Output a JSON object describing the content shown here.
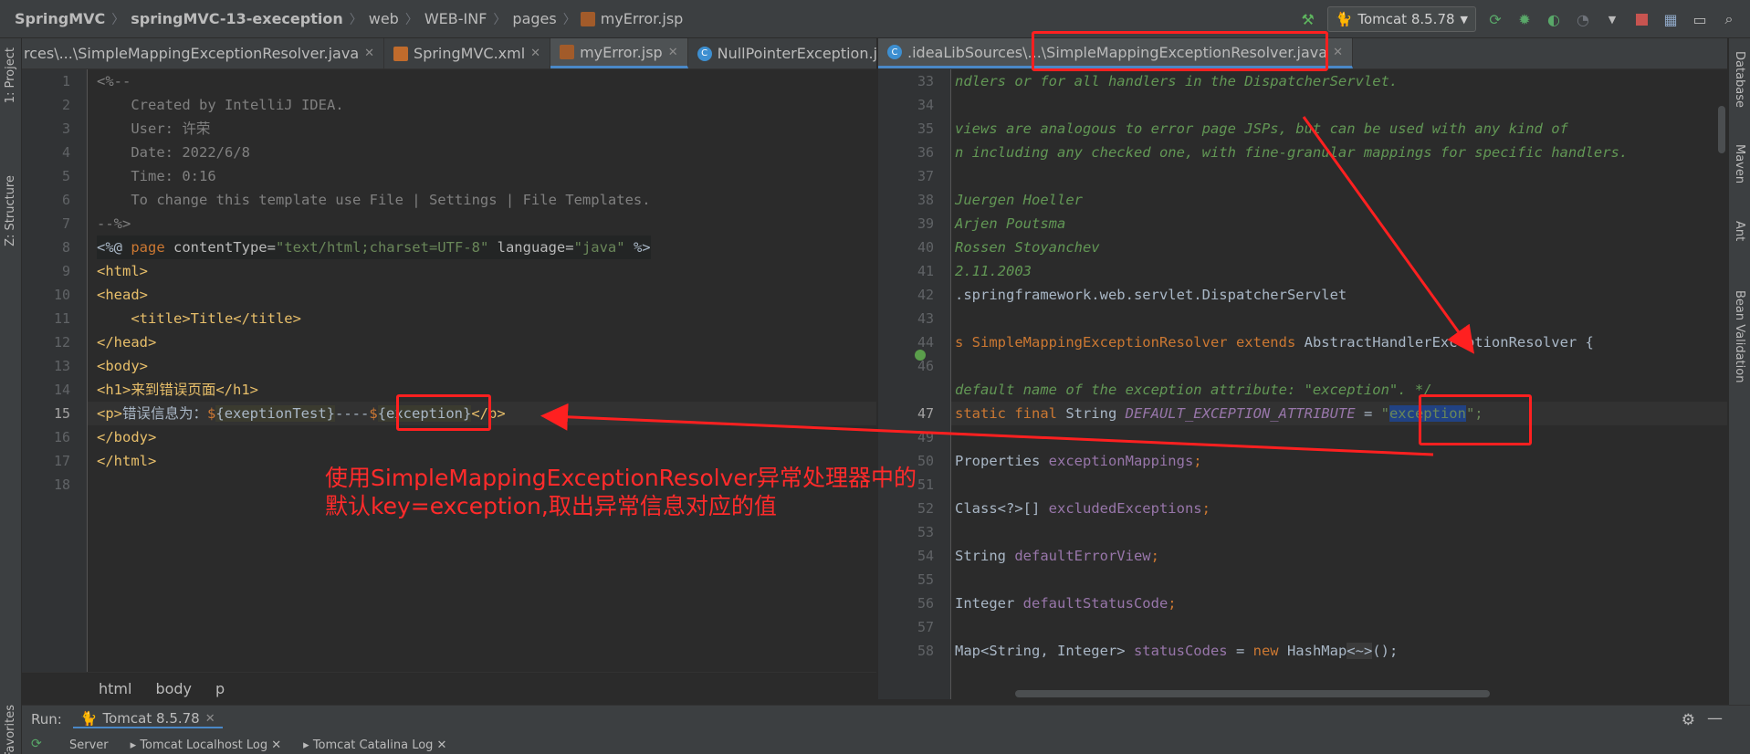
{
  "breadcrumbs": [
    {
      "label": "SpringMVC",
      "bold": true
    },
    {
      "label": "springMVC-13-exeception",
      "bold": true
    },
    {
      "label": "web",
      "bold": false
    },
    {
      "label": "WEB-INF",
      "bold": false
    },
    {
      "label": "pages",
      "bold": false
    },
    {
      "label": "myError.jsp",
      "bold": false
    }
  ],
  "toolbar": {
    "run_config": "Tomcat 8.5.78",
    "icons": [
      "hammer-icon",
      "rerun-icon",
      "debug-icon",
      "coverage-icon",
      "profile-icon",
      "stop-icon",
      "project-structure-icon",
      "terminal-icon",
      "search-icon"
    ]
  },
  "left_tool_strip": {
    "project": "1: Project",
    "structure": "Z: Structure",
    "favorites": "Favorites"
  },
  "right_tool_strip": {
    "database": "Database",
    "maven": "Maven",
    "ant": "Ant",
    "bean_validation": "Bean Validation"
  },
  "left_tabs": [
    {
      "label": "rces\\...\\SimpleMappingExceptionResolver.java",
      "icon": "java",
      "active": false,
      "close": true
    },
    {
      "label": "SpringMVC.xml",
      "icon": "xml",
      "active": false,
      "close": true
    },
    {
      "label": "myError.jsp",
      "icon": "jsp",
      "active": true,
      "close": true
    },
    {
      "label": "NullPointerException.jav",
      "icon": "java",
      "active": false,
      "close": false
    }
  ],
  "right_tabs": [
    {
      "label": ".ideaLibSources\\...\\SimpleMappingExceptionResolver.java",
      "icon": "java",
      "active": true,
      "close": true
    }
  ],
  "left_editor": {
    "line_numbers": [
      "1",
      "2",
      "3",
      "4",
      "5",
      "6",
      "7",
      "8",
      "9",
      "10",
      "11",
      "12",
      "13",
      "14",
      "15",
      "16",
      "17",
      "18"
    ],
    "current_line": "15",
    "lines": [
      "<%--",
      "    Created by IntelliJ IDEA.",
      "    User: 许荣",
      "    Date: 2022/6/8",
      "    Time: 0:16",
      "    To change this template use File | Settings | File Templates.",
      "--%>",
      "<%@ page contentType=\"text/html;charset=UTF-8\" language=\"java\" %>",
      "<html>",
      "<head>",
      "    <title>Title</title>",
      "</head>",
      "<body>",
      "<h1>来到错误页面</h1>",
      "<p>错误信息为：${exeptionTest}----${exception}</p>",
      "</body>",
      "</html>",
      ""
    ],
    "line15": {
      "open": "<p>",
      "text": "错误信息为：",
      "d1": "$",
      "el1": "{exeptionTest}",
      "mid": "----",
      "d2": "$",
      "el2": "{exception}",
      "close": "</p>"
    },
    "line8": {
      "open": "<%@ ",
      "kw": "page",
      "a1": " contentType=",
      "v1": "\"text/html;charset=UTF-8\"",
      "a2": " language=",
      "v2": "\"java\"",
      "end": " %>"
    }
  },
  "left_breadcrumb": [
    "html",
    "body",
    "p"
  ],
  "right_editor": {
    "line_numbers": [
      "33",
      "34",
      "35",
      "36",
      "37",
      "38",
      "39",
      "40",
      "41",
      "42",
      "43",
      "44",
      "46",
      "47",
      "49",
      "50",
      "51",
      "52",
      "53",
      "54",
      "55",
      "56",
      "57",
      "58"
    ],
    "current_line": "47",
    "lines": {
      "33": "ndlers or for all handlers in the DispatcherServlet.",
      "35": "views are analogous to error page JSPs, but can be used with any kind of",
      "36": "n including any checked one, with fine-granular mappings for specific handlers.",
      "38": "Juergen Hoeller",
      "39": "Arjen Poutsma",
      "40": "Rossen Stoyanchev",
      "41": "2.11.2003",
      "42": ".springframework.web.servlet.DispatcherServlet",
      "44a": "s SimpleMappingExceptionResolver ",
      "44b": "extends",
      "44c": " AbstractHandlerExceptionResolver {",
      "46": "default name of the exception attribute: \"exception\". */",
      "47a": "static final",
      "47b": " String ",
      "47c": "DEFAULT_EXCEPTION_ATTRIBUTE",
      "47d": " = ",
      "47e": "\"",
      "47f": "exception",
      "47g": "\";",
      "49a": "Properties ",
      "49b": "exceptionMappings",
      "51a": "Class<?>[] ",
      "51b": "excludedExceptions",
      "53a": "String ",
      "53b": "defaultErrorView",
      "55a": "Integer ",
      "55b": "defaultStatusCode",
      "57a": "Map<String, Integer> ",
      "57b": "statusCodes",
      "57c": " = ",
      "57d": "new",
      "57e": " HashMap",
      "57f": "<~>",
      "57g": "();"
    }
  },
  "annotation": {
    "line1": "使用SimpleMappingExceptionResolver异常处理器中的",
    "line2": "默认key=exception,取出异常信息对应的值"
  },
  "run_panel": {
    "label": "Run:",
    "tab": "Tomcat 8.5.78",
    "sub_tabs": [
      "Server",
      "Tomcat Localhost Log",
      "Tomcat Catalina Log"
    ]
  },
  "colors": {
    "accent": "#4a88c7",
    "annotation_red": "#ff2020",
    "background": "#2b2b2b"
  }
}
